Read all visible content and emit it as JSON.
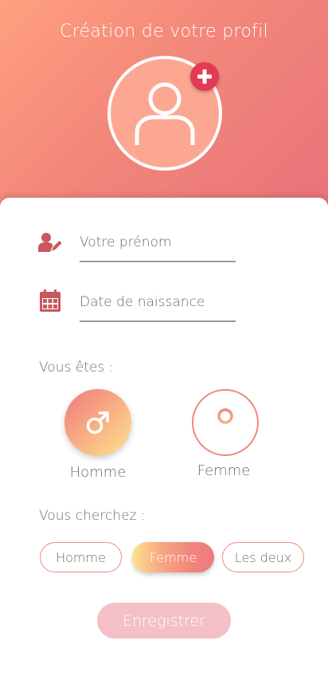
{
  "header": {
    "title": "Création de votre profil",
    "avatar_icon": "user-icon",
    "add_photo_icon": "plus-icon"
  },
  "form": {
    "firstname": {
      "placeholder": "Votre prénom",
      "value": "",
      "icon": "user-edit-icon"
    },
    "birthdate": {
      "placeholder": "Date de naissance",
      "value": "",
      "icon": "calendar-icon"
    }
  },
  "gender": {
    "label": "Vous êtes :",
    "options": [
      {
        "label": "Homme",
        "icon": "male-icon",
        "selected": true
      },
      {
        "label": "Femme",
        "icon": "female-icon",
        "selected": false
      }
    ]
  },
  "seeking": {
    "label": "Vous cherchez :",
    "options": [
      {
        "label": "Homme",
        "selected": false
      },
      {
        "label": "Femme",
        "selected": true
      },
      {
        "label": "Les deux",
        "selected": false
      }
    ]
  },
  "save_label": "Enregistrer",
  "colors": {
    "accent_red": "#e23b53",
    "icon_red": "#c8575e",
    "outline_coral": "#ef8b7f",
    "save_disabled": "#f4c0c7"
  }
}
